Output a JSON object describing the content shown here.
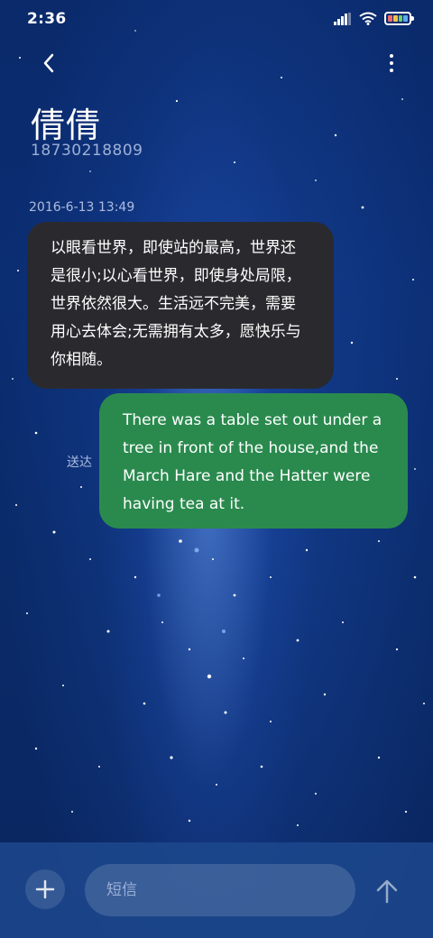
{
  "status_bar": {
    "time": "2:36",
    "icons": [
      "signal-icon",
      "wifi-icon",
      "battery-icon"
    ]
  },
  "header": {
    "back_icon": "chevron-left-icon",
    "more_icon": "more-vertical-icon",
    "contact_name": "倩倩",
    "contact_number": "18730218809"
  },
  "conversation": {
    "timestamp": "2016-6-13 13:49",
    "incoming": {
      "text": "以眼看世界，即使站的最高，世界还是很小;以心看世界，即使身处局限，世界依然很大。生活远不完美，需要用心去体会;无需拥有太多，愿快乐与你相随。",
      "bubble_color": "#2a2a2e"
    },
    "outgoing": {
      "text": "There was a table set out under a tree in front of the house,and the March Hare and the Hatter were having tea at it.",
      "bubble_color": "#2a8a4e",
      "status": "送达"
    }
  },
  "compose": {
    "attach_icon": "plus-icon",
    "placeholder": "短信",
    "value": "",
    "send_icon": "arrow-up-icon"
  },
  "colors": {
    "background": "#0b2d72",
    "compose_bar": "#1c488c"
  }
}
